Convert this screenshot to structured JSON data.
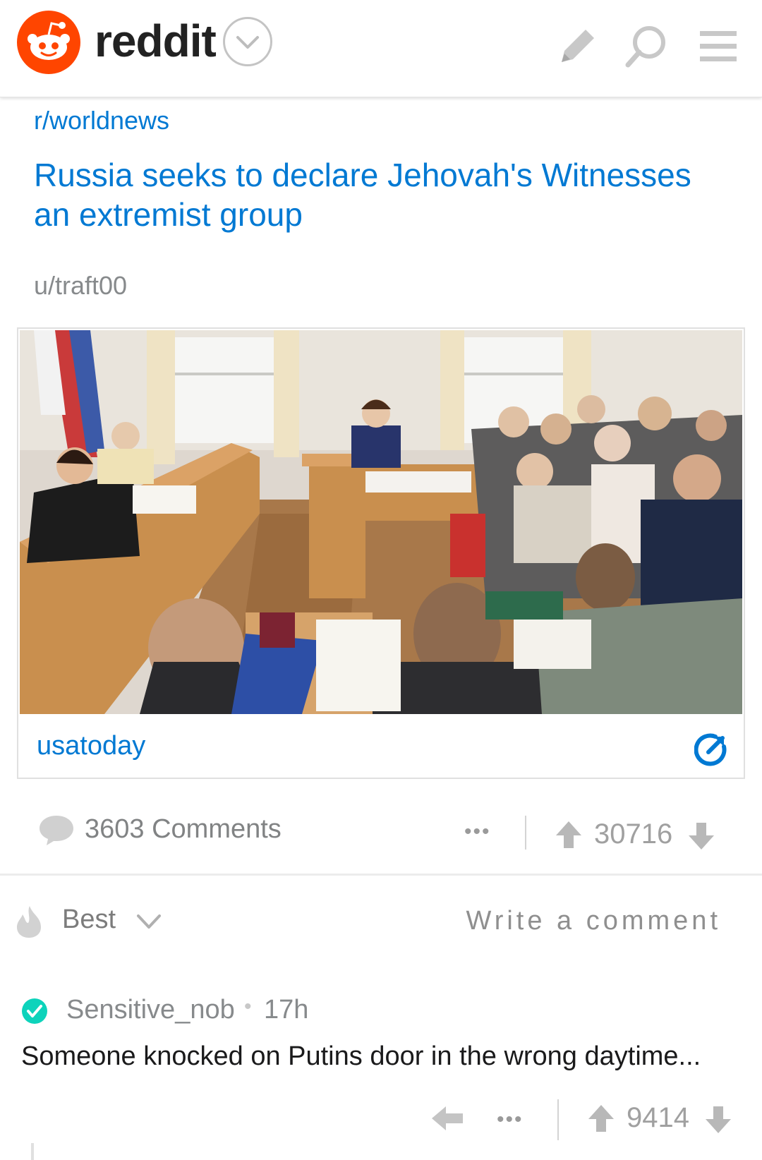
{
  "header": {
    "brand": "reddit",
    "icons": [
      "snoo-logo-icon",
      "chevron-down-icon",
      "pencil-icon",
      "search-icon",
      "menu-icon"
    ],
    "accent_color": "#ff4500"
  },
  "post": {
    "subreddit": "r/worldnews",
    "title": "Russia seeks to declare Jehovah's Witnesses an extremist group",
    "author": "u/traft00",
    "link_domain": "usatoday",
    "comments_label": "3603 Comments",
    "more_label": "•••",
    "score": "30716",
    "link_color": "#0079d3"
  },
  "sort": {
    "label": "Best",
    "write_comment": "Write a comment"
  },
  "comment": {
    "author": "Sensitive_nob",
    "separator": "•",
    "time": "17h",
    "body": "Someone knocked on Putins door in the wrong daytime...",
    "more_label": "•••",
    "score": "9414",
    "verified_color": "#0dd3bb"
  }
}
